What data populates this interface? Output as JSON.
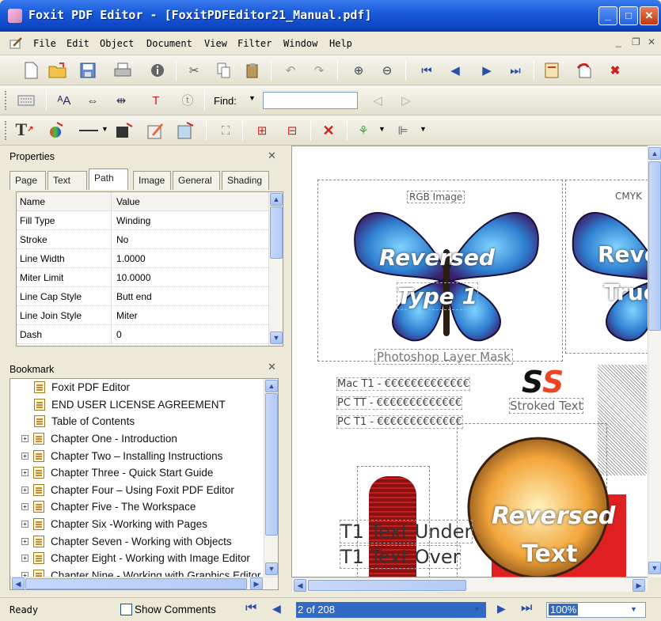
{
  "window": {
    "title": "Foxit PDF Editor - [FoxitPDFEditor21_Manual.pdf]",
    "minimize": "_",
    "maximize": "□",
    "close": "✕"
  },
  "menu": {
    "items": [
      "File",
      "Edit",
      "Object",
      "Document",
      "View",
      "Filter",
      "Window",
      "Help"
    ]
  },
  "toolbar": {
    "find_label": "Find:",
    "find_value": ""
  },
  "properties": {
    "title": "Properties",
    "close": "✕",
    "tabs": [
      "Page",
      "Text",
      "Path",
      "Image",
      "General",
      "Shading"
    ],
    "active_tab": "Path",
    "columns": [
      "Name",
      "Value"
    ],
    "rows": [
      {
        "name": "Fill Type",
        "value": "Winding"
      },
      {
        "name": "Stroke",
        "value": "No"
      },
      {
        "name": "Line Width",
        "value": "1.0000"
      },
      {
        "name": "Miter Limit",
        "value": "10.0000"
      },
      {
        "name": "Line Cap Style",
        "value": "Butt end"
      },
      {
        "name": "Line Join Style",
        "value": "Miter"
      },
      {
        "name": "Dash",
        "value": "0"
      }
    ]
  },
  "bookmark": {
    "title": "Bookmark",
    "close": "✕",
    "items": [
      {
        "label": "Foxit PDF Editor",
        "expandable": false
      },
      {
        "label": "END USER LICENSE AGREEMENT",
        "expandable": false
      },
      {
        "label": "Table of Contents",
        "expandable": false
      },
      {
        "label": "Chapter One - Introduction",
        "expandable": true
      },
      {
        "label": "Chapter Two – Installing Instructions",
        "expandable": true
      },
      {
        "label": "Chapter Three - Quick Start Guide",
        "expandable": true
      },
      {
        "label": "Chapter Four – Using Foxit PDF Editor",
        "expandable": true
      },
      {
        "label": "Chapter Five - The Workspace",
        "expandable": true
      },
      {
        "label": "Chapter Six -Working with Pages",
        "expandable": true
      },
      {
        "label": "Chapter Seven - Working with Objects",
        "expandable": true
      },
      {
        "label": "Chapter Eight - Working with Image Editor",
        "expandable": true
      },
      {
        "label": "Chapter Nine - Working with Graphics Editor",
        "expandable": true
      }
    ]
  },
  "document": {
    "labels": {
      "rgb": "RGB Image",
      "cmyk": "CMYK",
      "reversed1": "Reversed",
      "type1": "Type 1",
      "reversed2": "Reve",
      "true2": "True",
      "layer_mask": "Photoshop Layer Mask",
      "mac": "Mac T1 - €€€€€€€€€€€€€",
      "pc1": "PC TT - €€€€€€€€€€€€€",
      "pc2": "PC T1 - €€€€€€€€€€€€€",
      "ss": "SS",
      "stroked": "Stroked Text",
      "reversed3": "Reversed",
      "text3": "Text",
      "tt1": "T1 Text Under",
      "tt2": "T1 Text Over"
    }
  },
  "status": {
    "ready": "Ready",
    "show_comments": "Show Comments",
    "page": "2 of 208",
    "zoom": "100%"
  },
  "colors": {
    "titlebar": "#0c46c4",
    "accent": "#316ac5"
  }
}
